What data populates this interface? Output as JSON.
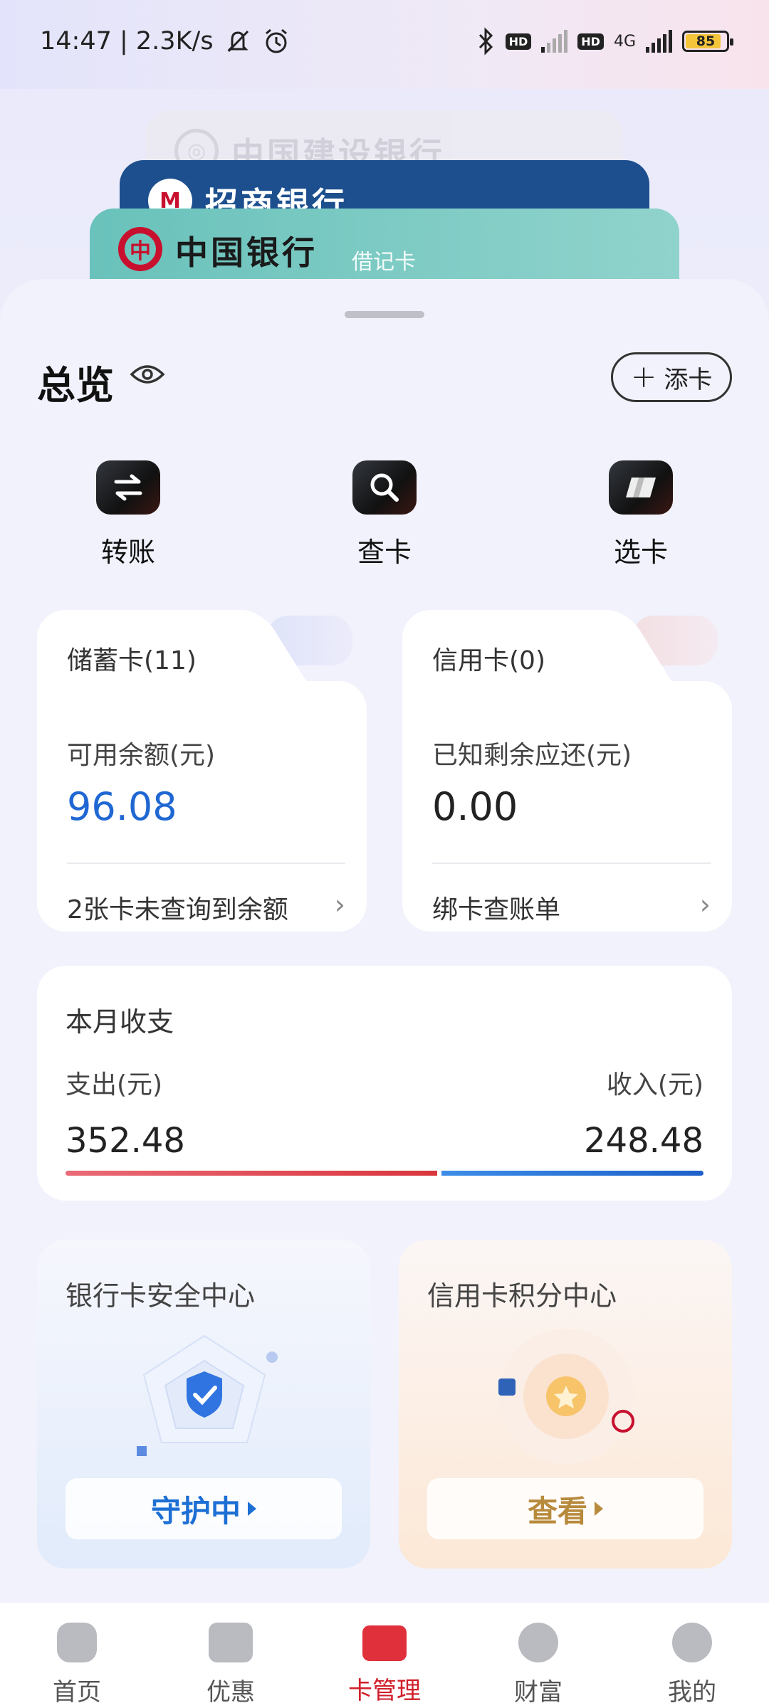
{
  "status_bar": {
    "time_speed": "14:47 | 2.3K/s",
    "network_label": "4G",
    "battery": "85"
  },
  "cards_stack": [
    {
      "bank": "中国建设银行",
      "logo": "ccb-logo"
    },
    {
      "bank": "招商银行",
      "logo": "cmb-logo"
    },
    {
      "bank": "中国银行",
      "logo": "boc-logo",
      "type": "借记卡"
    }
  ],
  "overview": {
    "title": "总览",
    "add_card_label": "添卡"
  },
  "quick_actions": [
    {
      "label": "转账",
      "icon": "transfer-icon"
    },
    {
      "label": "查卡",
      "icon": "search-icon"
    },
    {
      "label": "选卡",
      "icon": "card-select-icon"
    }
  ],
  "debit": {
    "title": "储蓄卡(11)",
    "label": "可用余额(元)",
    "value": "96.08",
    "link": "2张卡未查询到余额",
    "value_color": "#1f67d3"
  },
  "credit": {
    "title": "信用卡(0)",
    "label": "已知剩余应还(元)",
    "value": "0.00",
    "link": "绑卡查账单",
    "value_color": "#222222"
  },
  "monthly": {
    "title": "本月收支",
    "expense_label": "支出(元)",
    "income_label": "收入(元)",
    "expense": 352.48,
    "income": 248.48,
    "expense_text": "352.48",
    "income_text": "248.48"
  },
  "security_center": {
    "title": "银行卡安全中心",
    "button": "守护中"
  },
  "points_center": {
    "title": "信用卡积分中心",
    "button": "查看"
  },
  "nav": [
    {
      "label": "首页",
      "icon": "home-icon",
      "active": false
    },
    {
      "label": "优惠",
      "icon": "discount-icon",
      "active": false
    },
    {
      "label": "卡管理",
      "icon": "card-manage-icon",
      "active": true
    },
    {
      "label": "财富",
      "icon": "wealth-icon",
      "active": false
    },
    {
      "label": "我的",
      "icon": "profile-icon",
      "active": false
    }
  ],
  "colors": {
    "accent_red": "#d11f2b",
    "accent_blue": "#1f67d3"
  }
}
